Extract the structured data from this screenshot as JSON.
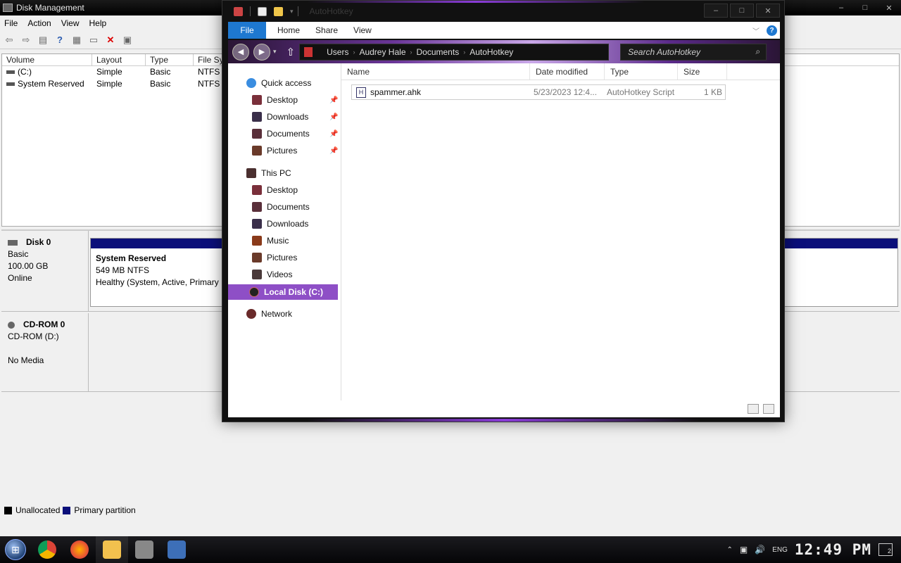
{
  "disk_mgmt": {
    "title": "Disk Management",
    "menu": [
      "File",
      "Action",
      "View",
      "Help"
    ],
    "columns": [
      "Volume",
      "Layout",
      "Type",
      "File Sys"
    ],
    "rows": [
      {
        "volume": "(C:)",
        "layout": "Simple",
        "type": "Basic",
        "fs": "NTFS"
      },
      {
        "volume": "System Reserved",
        "layout": "Simple",
        "type": "Basic",
        "fs": "NTFS"
      }
    ],
    "disk0": {
      "name": "Disk 0",
      "kind": "Basic",
      "size": "100.00 GB",
      "status": "Online",
      "partition": {
        "name": "System Reserved",
        "size": "549 MB NTFS",
        "health": "Healthy (System, Active, Primary"
      }
    },
    "cdrom": {
      "name": "CD-ROM 0",
      "drive": "CD-ROM (D:)",
      "media": "No Media"
    },
    "legend": [
      {
        "label": "Unallocated",
        "color": "#000000"
      },
      {
        "label": "Primary partition",
        "color": "#0b0f7a"
      }
    ]
  },
  "explorer": {
    "title": "AutoHotkey",
    "ribbon": {
      "file": "File",
      "tabs": [
        "Home",
        "Share",
        "View"
      ]
    },
    "breadcrumb": [
      "Users",
      "Audrey Hale",
      "Documents",
      "AutoHotkey"
    ],
    "search_placeholder": "Search AutoHotkey",
    "nav": {
      "quick_access": "Quick access",
      "quick_items": [
        "Desktop",
        "Downloads",
        "Documents",
        "Pictures"
      ],
      "this_pc": "This PC",
      "pc_items": [
        "Desktop",
        "Documents",
        "Downloads",
        "Music",
        "Pictures",
        "Videos"
      ],
      "local_disk": "Local Disk (C:)",
      "network": "Network"
    },
    "columns": [
      "Name",
      "Date modified",
      "Type",
      "Size"
    ],
    "files": [
      {
        "name": "spammer.ahk",
        "date": "5/23/2023 12:4...",
        "type": "AutoHotkey Script",
        "size": "1 KB"
      }
    ]
  },
  "taskbar": {
    "time": "12:49 PM",
    "lang": "ENG",
    "notifications": "2"
  },
  "colors": {
    "accent": "#8e4fc6",
    "file_tab": "#1e78d0",
    "partition_bar": "#0b0f7a"
  }
}
